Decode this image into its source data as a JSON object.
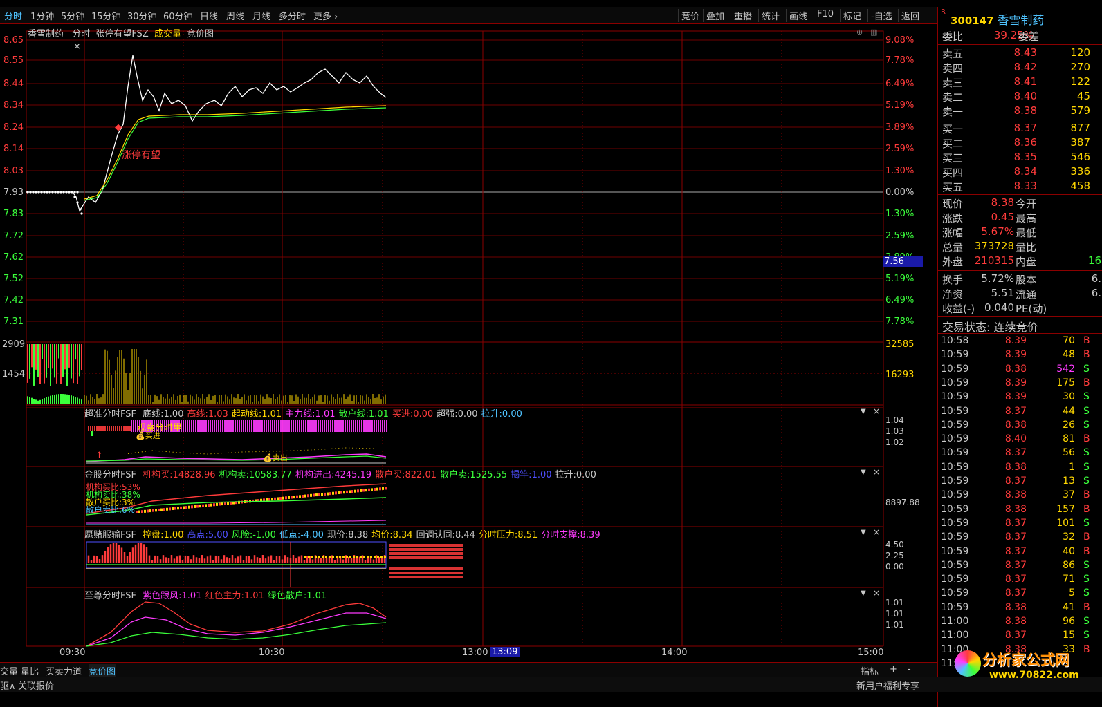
{
  "toolbar": {
    "periods": [
      "分时",
      "1分钟",
      "5分钟",
      "15分钟",
      "30分钟",
      "60分钟",
      "日线",
      "周线",
      "月线",
      "多分时",
      "更多"
    ],
    "right_buttons": [
      "竞价",
      "叠加",
      "重播",
      "统计",
      "画线",
      "F10",
      "标记",
      "-自选",
      "返回"
    ]
  },
  "chart_header": {
    "stock_name": "香雪制药",
    "mode": "分时",
    "formula": "张停有望FSZ",
    "volume": "成交量",
    "auction": "竞价图"
  },
  "price_axis_left": [
    "8.65",
    "8.55",
    "8.44",
    "8.34",
    "8.24",
    "8.14",
    "8.03",
    "7.93",
    "7.83",
    "7.72",
    "7.62",
    "7.52",
    "7.42",
    "7.31"
  ],
  "pct_axis_right": [
    "9.08%",
    "7.78%",
    "6.49%",
    "5.19%",
    "3.89%",
    "2.59%",
    "1.30%",
    "0.00%",
    "1.30%",
    "2.59%",
    "3.89%",
    "5.19%",
    "6.49%",
    "7.78%"
  ],
  "cursor_price": "7.56",
  "annotation": "涨停有望",
  "volume_axis": {
    "left_top": "2909",
    "left_mid": "1454",
    "right_top": "32585",
    "right_mid": "16293"
  },
  "ind1": {
    "title": "超准分时FSF",
    "items": [
      {
        "label": "底线:",
        "value": "1.00",
        "color": "#c8c8c8"
      },
      {
        "label": "高线:",
        "value": "1.03",
        "color": "#ff3b3b"
      },
      {
        "label": "起动线:",
        "value": "1.01",
        "color": "#ffd700"
      },
      {
        "label": "主力线:",
        "value": "1.01",
        "color": "#ff3bff"
      },
      {
        "label": "散户线:",
        "value": "1.01",
        "color": "#3bff3b"
      },
      {
        "label": "买进:",
        "value": "0.00",
        "color": "#ff3b3b"
      },
      {
        "label": "超强:",
        "value": "0.00",
        "color": "#c8c8c8"
      },
      {
        "label": "拉升:",
        "value": "0.00",
        "color": "#4fc3ff"
      }
    ],
    "axis": [
      "1.04",
      "1.03",
      "1.02"
    ],
    "label_pink": "观察分时里",
    "label_buy": "买进",
    "label_sell": "卖出"
  },
  "ind2": {
    "title": "金股分时FSF",
    "items": [
      {
        "label": "机构买:",
        "value": "14828.96",
        "color": "#ff3b3b"
      },
      {
        "label": "机构卖:",
        "value": "10583.77",
        "color": "#3bff3b"
      },
      {
        "label": "机构进出:",
        "value": "4245.19",
        "color": "#ff3bff"
      },
      {
        "label": "散户买:",
        "value": "822.01",
        "color": "#ff3b3b"
      },
      {
        "label": "散户卖:",
        "value": "1525.55",
        "color": "#3bff3b"
      },
      {
        "label": "揭竿:",
        "value": "1.00",
        "color": "#4f4fff"
      },
      {
        "label": "拉升:",
        "value": "0.00",
        "color": "#c8c8c8"
      }
    ],
    "axis": "8897.88",
    "legend": [
      "机构买比:53%",
      "机构卖比:38%",
      "散户买比:3%",
      "散户卖比:6%"
    ]
  },
  "ind3": {
    "title": "愿赌服输FSF",
    "items": [
      {
        "label": "控盘:",
        "value": "1.00",
        "color": "#ffd700"
      },
      {
        "label": "高点:",
        "value": "5.00",
        "color": "#4f4fff"
      },
      {
        "label": "风险:",
        "value": "-1.00",
        "color": "#3bff3b"
      },
      {
        "label": "低点:",
        "value": "-4.00",
        "color": "#4fc3ff"
      },
      {
        "label": "现价:",
        "value": "8.38",
        "color": "#c8c8c8"
      },
      {
        "label": "均价:",
        "value": "8.34",
        "color": "#ffd700"
      },
      {
        "label": "回调认同:",
        "value": "8.44",
        "color": "#c8c8c8"
      },
      {
        "label": "分时压力:",
        "value": "8.51",
        "color": "#ffd700"
      },
      {
        "label": "分时支撑:",
        "value": "8.39",
        "color": "#ff3bff"
      }
    ],
    "axis": [
      "4.50",
      "2.25",
      "0.00"
    ]
  },
  "ind4": {
    "title": "至尊分时FSF",
    "items": [
      {
        "label": "紫色跟风:",
        "value": "1.01",
        "color": "#ff3bff"
      },
      {
        "label": "红色主力:",
        "value": "1.01",
        "color": "#ff3b3b"
      },
      {
        "label": "绿色散户:",
        "value": "1.01",
        "color": "#3bff3b"
      }
    ],
    "axis": [
      "1.01",
      "1.01",
      "1.01"
    ]
  },
  "time_axis": [
    "09:30",
    "10:30",
    "13:00",
    "14:00",
    "15:00"
  ],
  "time_cursor": "13:09",
  "quote": {
    "code": "300147",
    "name": "香雪制药",
    "badge": "R",
    "weibi_label": "委比",
    "weibi_value": "39.25%",
    "weicha_label": "委差",
    "sell": [
      {
        "label": "卖五",
        "price": "8.43",
        "vol": "120"
      },
      {
        "label": "卖四",
        "price": "8.42",
        "vol": "270"
      },
      {
        "label": "卖三",
        "price": "8.41",
        "vol": "122"
      },
      {
        "label": "卖二",
        "price": "8.40",
        "vol": "45"
      },
      {
        "label": "卖一",
        "price": "8.38",
        "vol": "579"
      }
    ],
    "buy": [
      {
        "label": "买一",
        "price": "8.37",
        "vol": "877"
      },
      {
        "label": "买二",
        "price": "8.36",
        "vol": "387"
      },
      {
        "label": "买三",
        "price": "8.35",
        "vol": "546"
      },
      {
        "label": "买四",
        "price": "8.34",
        "vol": "336"
      },
      {
        "label": "买五",
        "price": "8.33",
        "vol": "458"
      }
    ],
    "stats": [
      {
        "l1": "现价",
        "v1": "8.38",
        "l2": "今开",
        "c": "#ff3b3b"
      },
      {
        "l1": "涨跌",
        "v1": "0.45",
        "l2": "最高",
        "c": "#ff3b3b"
      },
      {
        "l1": "涨幅",
        "v1": "5.67%",
        "l2": "最低",
        "c": "#ff3b3b"
      },
      {
        "l1": "总量",
        "v1": "373728",
        "l2": "量比",
        "c": "#ffd700"
      },
      {
        "l1": "外盘",
        "v1": "210315",
        "l2": "内盘",
        "c": "#ff3b3b",
        "v2": "16"
      }
    ],
    "stats2": [
      {
        "l1": "换手",
        "v1": "5.72%",
        "l2": "股本",
        "v2": "6."
      },
      {
        "l1": "净资",
        "v1": "5.51",
        "l2": "流通",
        "v2": "6."
      },
      {
        "l1": "收益(-)",
        "v1": "0.040",
        "l2": "PE(动)",
        "v2": ""
      }
    ],
    "trade_status": "交易状态: 连续竞价",
    "ticks": [
      {
        "t": "10:58",
        "p": "8.39",
        "v": "70",
        "bs": "B"
      },
      {
        "t": "10:59",
        "p": "8.39",
        "v": "48",
        "bs": "B"
      },
      {
        "t": "10:59",
        "p": "8.38",
        "v": "542",
        "bs": "S"
      },
      {
        "t": "10:59",
        "p": "8.39",
        "v": "175",
        "bs": "B"
      },
      {
        "t": "10:59",
        "p": "8.39",
        "v": "30",
        "bs": "S"
      },
      {
        "t": "10:59",
        "p": "8.37",
        "v": "44",
        "bs": "S"
      },
      {
        "t": "10:59",
        "p": "8.38",
        "v": "26",
        "bs": "S"
      },
      {
        "t": "10:59",
        "p": "8.40",
        "v": "81",
        "bs": "B"
      },
      {
        "t": "10:59",
        "p": "8.37",
        "v": "56",
        "bs": "S"
      },
      {
        "t": "10:59",
        "p": "8.38",
        "v": "1",
        "bs": "S"
      },
      {
        "t": "10:59",
        "p": "8.37",
        "v": "13",
        "bs": "S"
      },
      {
        "t": "10:59",
        "p": "8.38",
        "v": "37",
        "bs": "B"
      },
      {
        "t": "10:59",
        "p": "8.38",
        "v": "157",
        "bs": "B"
      },
      {
        "t": "10:59",
        "p": "8.37",
        "v": "101",
        "bs": "S"
      },
      {
        "t": "10:59",
        "p": "8.37",
        "v": "32",
        "bs": "B"
      },
      {
        "t": "10:59",
        "p": "8.37",
        "v": "40",
        "bs": "B"
      },
      {
        "t": "10:59",
        "p": "8.37",
        "v": "86",
        "bs": "S"
      },
      {
        "t": "10:59",
        "p": "8.37",
        "v": "71",
        "bs": "S"
      },
      {
        "t": "10:59",
        "p": "8.37",
        "v": "5",
        "bs": "S"
      },
      {
        "t": "10:59",
        "p": "8.38",
        "v": "41",
        "bs": "B"
      },
      {
        "t": "11:00",
        "p": "8.38",
        "v": "96",
        "bs": "S"
      },
      {
        "t": "11:00",
        "p": "8.37",
        "v": "15",
        "bs": "S"
      },
      {
        "t": "11:00",
        "p": "8.38",
        "v": "33",
        "bs": "B"
      },
      {
        "t": "11:",
        "p": "",
        "v": "",
        "bs": ""
      }
    ]
  },
  "bottom_tabs": [
    "交量",
    "量比",
    "买卖力道",
    "竞价图"
  ],
  "bottom_right": [
    "指标",
    "+",
    "-"
  ],
  "status_bar": {
    "left": "驱∧",
    "quote_link": "关联报价",
    "promo": "新用户福利专享"
  },
  "logo": {
    "name": "分析家公式网",
    "url": "www.70822.com"
  },
  "colors": {
    "up": "#ff3b3b",
    "down": "#3bff3b",
    "grid": "#8b0000",
    "bg": "#000000",
    "avg_line": "#ffd700",
    "price_line": "#ffffff"
  }
}
